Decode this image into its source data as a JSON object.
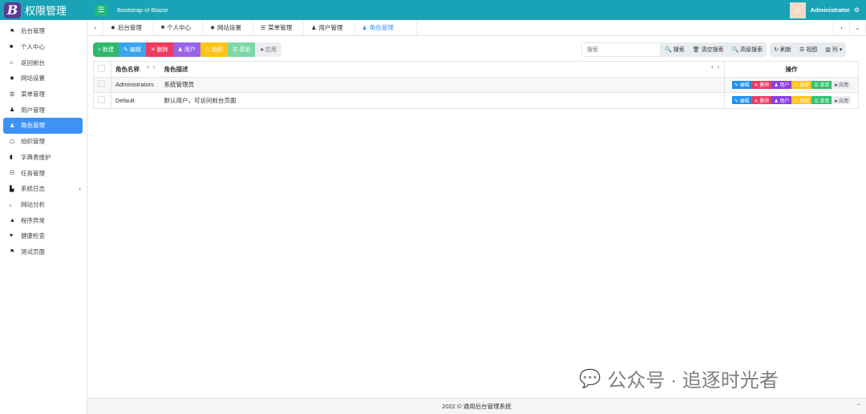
{
  "header": {
    "logo_letter": "B",
    "title": "权限管理",
    "app_title": "Bootstrap of Blazor",
    "user": "Administrator"
  },
  "sidebar": [
    {
      "icon": "flag-icon",
      "glyph": "⚑",
      "label": "后台管理"
    },
    {
      "icon": "briefcase-icon",
      "glyph": "■",
      "label": "个人中心"
    },
    {
      "icon": "home-icon",
      "glyph": "⌂",
      "label": "返回前台"
    },
    {
      "icon": "gear-icon",
      "glyph": "✹",
      "label": "网站设置"
    },
    {
      "icon": "bars-icon",
      "glyph": "☰",
      "label": "菜单管理"
    },
    {
      "icon": "user-cog-icon",
      "glyph": "♟",
      "label": "用户管理"
    },
    {
      "icon": "users-icon",
      "glyph": "♟",
      "label": "角色管理",
      "active": true
    },
    {
      "icon": "sitemap-icon",
      "glyph": "☖",
      "label": "组织管理"
    },
    {
      "icon": "book-icon",
      "glyph": "▮",
      "label": "字典表维护"
    },
    {
      "icon": "tasks-icon",
      "glyph": "☷",
      "label": "任务管理"
    },
    {
      "icon": "log-icon",
      "glyph": "▙",
      "label": "系统日志",
      "arrow": "‹"
    },
    {
      "icon": "chart-icon",
      "glyph": "⌞",
      "label": "网站分析"
    },
    {
      "icon": "warning-icon",
      "glyph": "▲",
      "label": "程序异常"
    },
    {
      "icon": "heartbeat-icon",
      "glyph": "♥",
      "label": "健康检查"
    },
    {
      "icon": "flag-icon",
      "glyph": "⚑",
      "label": "测试页面"
    }
  ],
  "tabs": [
    {
      "glyph": "✹",
      "label": "后台管理"
    },
    {
      "glyph": "■",
      "label": "个人中心"
    },
    {
      "glyph": "✹",
      "label": "网站设置"
    },
    {
      "glyph": "☰",
      "label": "菜单管理"
    },
    {
      "glyph": "♟",
      "label": "用户管理"
    },
    {
      "glyph": "♟",
      "label": "角色管理",
      "active": true
    }
  ],
  "toolbar": [
    {
      "label": "+ 新建",
      "color": "#2fb86e"
    },
    {
      "label": "✎ 编辑",
      "color": "#3aa4ec"
    },
    {
      "label": "✕ 删除",
      "color": "#ec3a61"
    },
    {
      "label": "♟ 用户",
      "color": "#9b63e8"
    },
    {
      "label": "☖ 组织",
      "color": "#fcc419"
    },
    {
      "label": "☰ 菜单",
      "color": "#7dd8a6"
    },
    {
      "label": "♣ 应用",
      "color": "#eceef1"
    }
  ],
  "search": {
    "placeholder": "搜索",
    "search": "🔍 搜索",
    "clear": "🗑 清空搜索",
    "advanced": "🔍 高级搜索",
    "refresh": "↻ 刷新",
    "view": "☰ 视图",
    "columns": "▥ 列 ▾"
  },
  "table": {
    "headers": [
      "角色名称",
      "角色描述",
      "操作"
    ],
    "rows": [
      [
        "Administrators",
        "系统管理员"
      ],
      [
        "Default",
        "默认用户，可访问前台页面"
      ]
    ],
    "actions": [
      {
        "label": "✎ 编辑",
        "color": "#1e90f0"
      },
      {
        "label": "✕ 删除",
        "color": "#ec3a61"
      },
      {
        "label": "♟ 用户",
        "color": "#8a3ee0"
      },
      {
        "label": "☖ 组织",
        "color": "#fcc419"
      },
      {
        "label": "☰ 菜单",
        "color": "#2fc170"
      },
      {
        "label": "♣ 应用",
        "color": "#e9ecef"
      }
    ]
  },
  "footer": "2022 © 通用后台管理系统",
  "watermark": "公众号 · 追逐时光者"
}
